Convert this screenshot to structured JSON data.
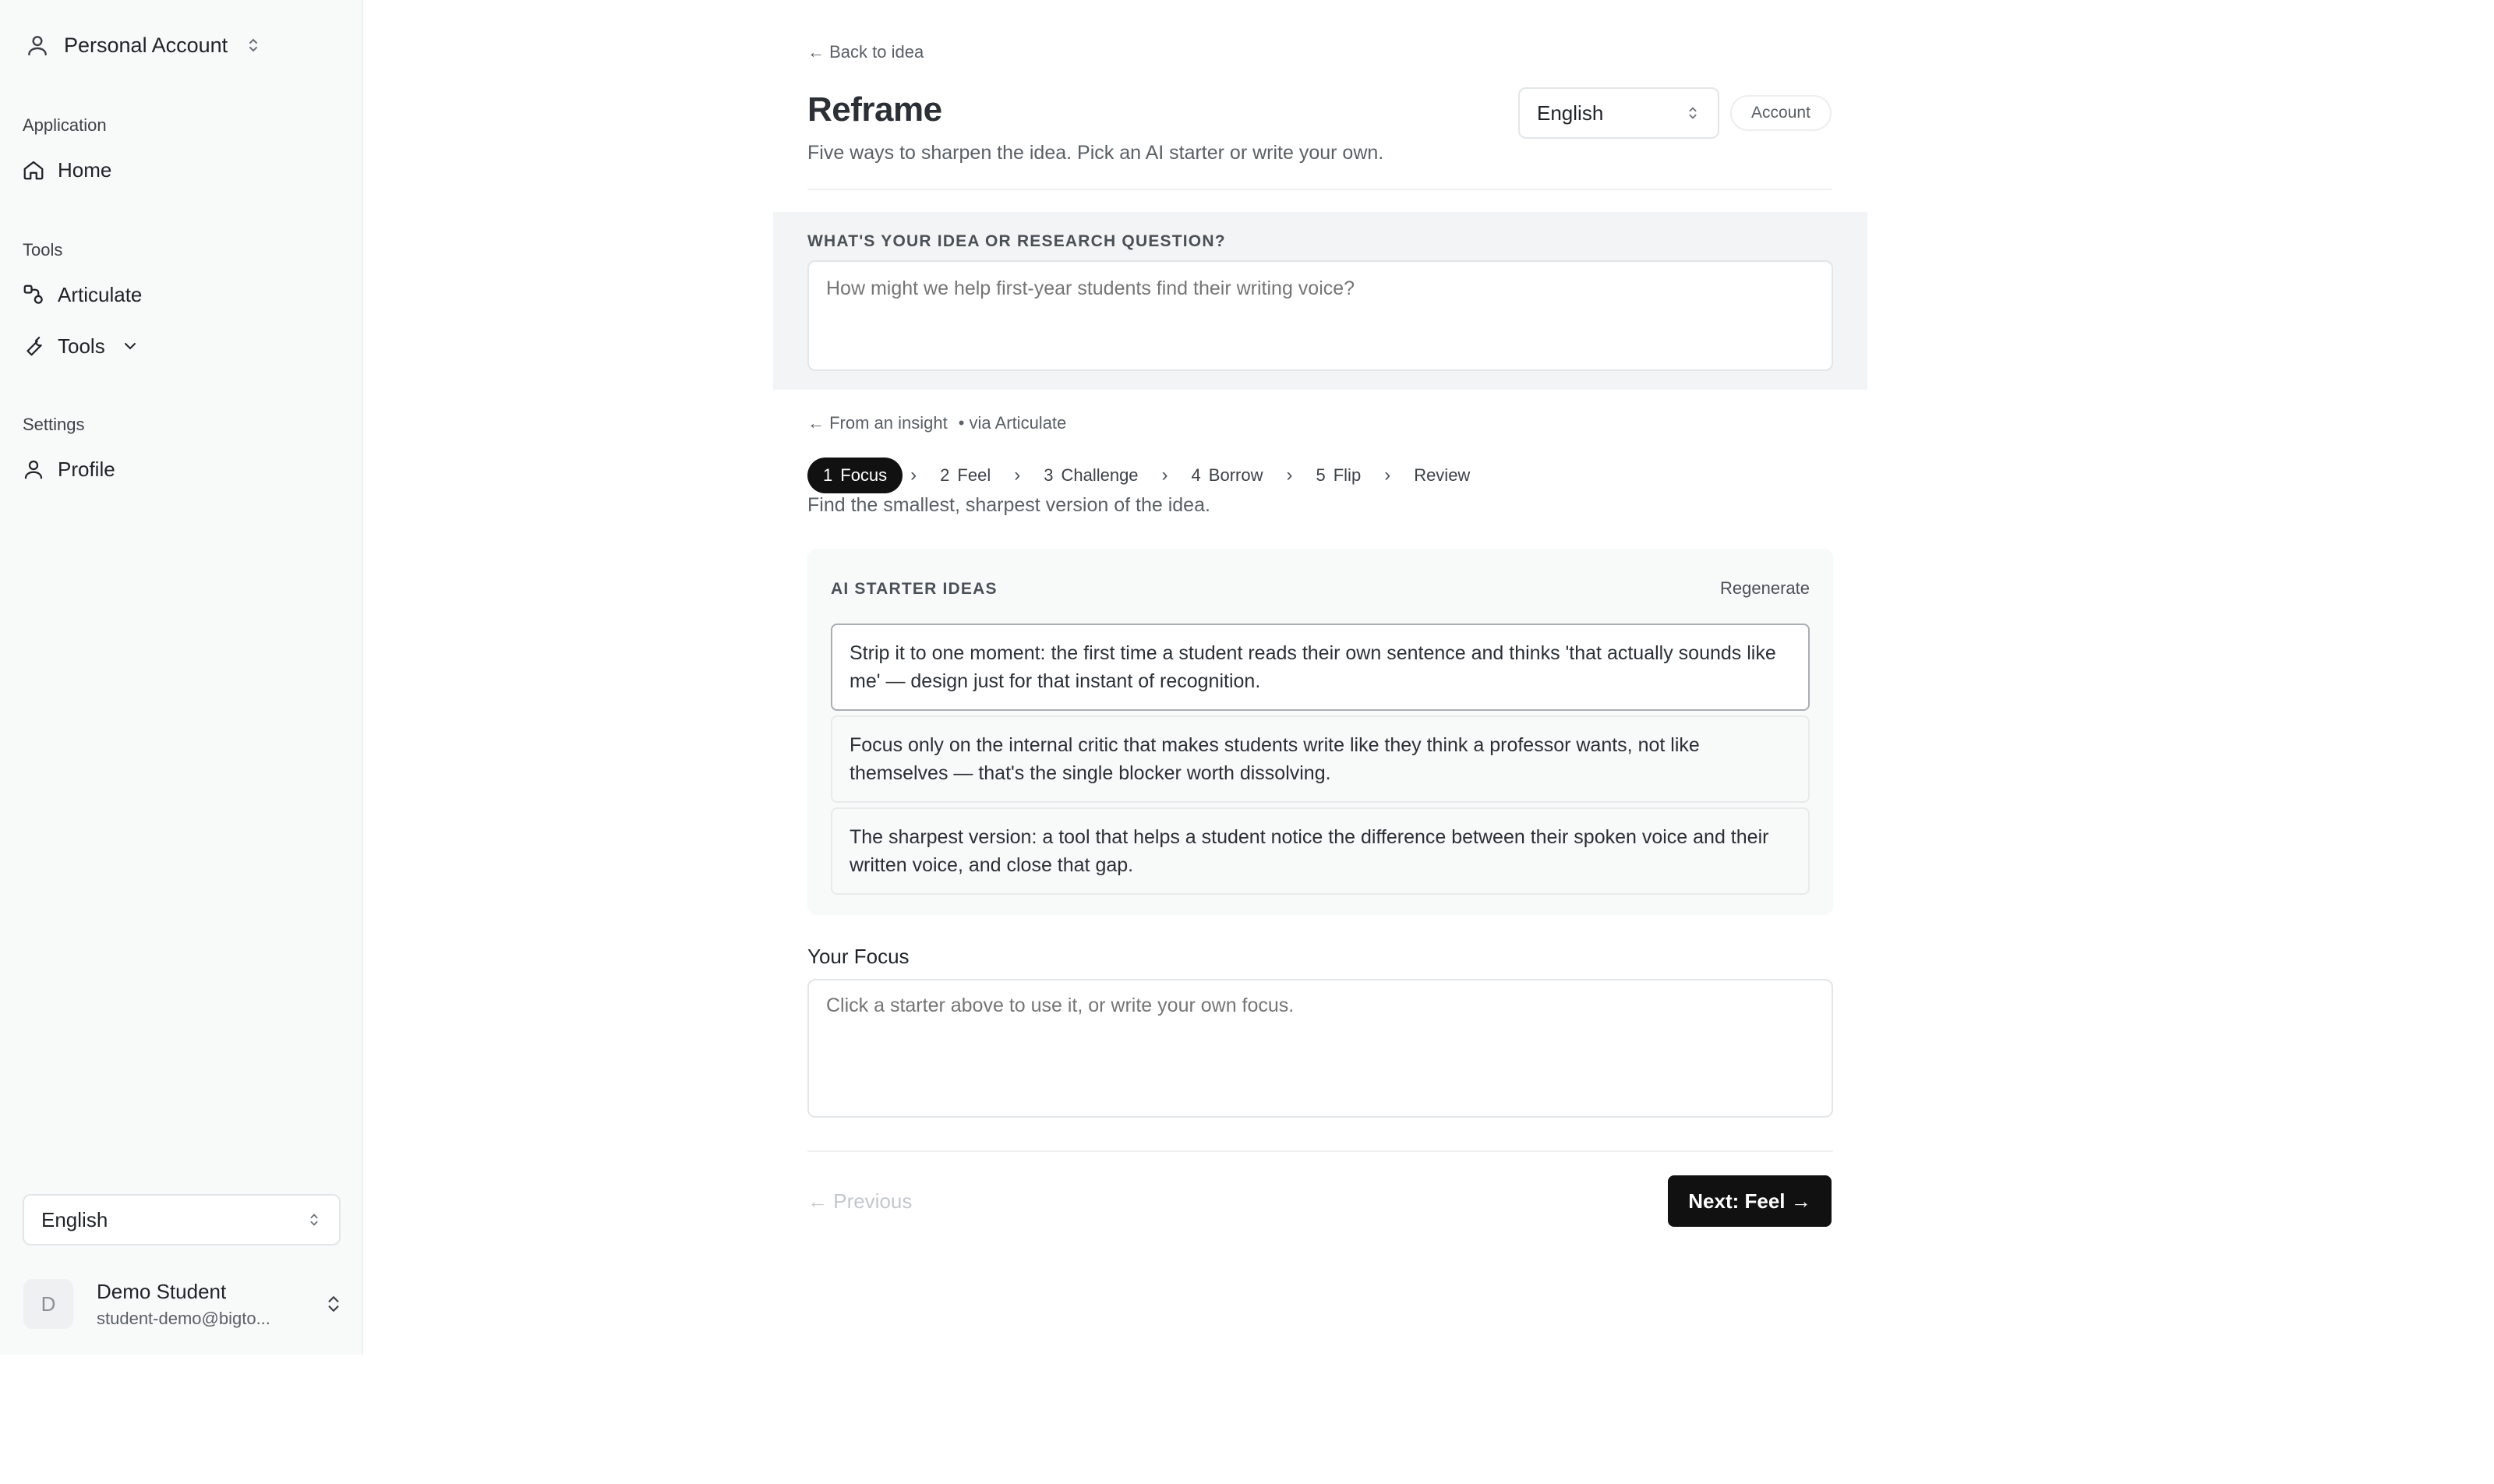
{
  "sidebar": {
    "account_switcher": {
      "label": "Personal Account",
      "icon": "user-icon"
    },
    "groups": [
      {
        "label": "Application",
        "items": [
          {
            "label": "Home",
            "icon": "home-icon"
          }
        ]
      },
      {
        "label": "Tools",
        "items": [
          {
            "label": "Articulate",
            "icon": "articulate-icon"
          },
          {
            "label": "Tools",
            "icon": "wrench-icon"
          }
        ]
      },
      {
        "label": "Settings",
        "items": [
          {
            "label": "Profile",
            "icon": "user-icon"
          }
        ]
      }
    ],
    "language": "English",
    "user": {
      "initial": "D",
      "name": "Demo Student",
      "email": "student-demo@bigto..."
    }
  },
  "header": {
    "back_link": "← Back to idea",
    "title": "Reframe",
    "subtitle": "Five ways to sharpen the idea. Pick an AI starter or write your own.",
    "language": "English",
    "account_button": "Account"
  },
  "question": {
    "label": "WHAT'S YOUR IDEA OR RESEARCH QUESTION?",
    "placeholder": "How might we help first-year students find their writing voice?"
  },
  "source": {
    "from": "← From an insight",
    "via": "• via Articulate"
  },
  "steps": [
    {
      "num": "1",
      "label": "Focus",
      "active": true
    },
    {
      "num": "2",
      "label": "Feel",
      "active": false
    },
    {
      "num": "3",
      "label": "Challenge",
      "active": false
    },
    {
      "num": "4",
      "label": "Borrow",
      "active": false
    },
    {
      "num": "5",
      "label": "Flip",
      "active": false
    },
    {
      "num": "",
      "label": "Review",
      "active": false
    }
  ],
  "step_separator": "›",
  "step_description": "Find the smallest, sharpest version of the idea.",
  "starters": {
    "heading": "AI STARTER IDEAS",
    "regenerate": "Regenerate",
    "items": [
      "Strip it to one moment: the first time a student reads their own sentence and thinks 'that actually sounds like me' — design just for that instant of recognition.",
      "Focus only on the internal critic that makes students write like they think a professor wants, not like themselves — that's the single blocker worth dissolving.",
      "The sharpest version: a tool that helps a student notice the difference between their spoken voice and their written voice, and close that gap."
    ]
  },
  "focus": {
    "label": "Your Focus",
    "placeholder": "Click a starter above to use it, or write your own focus."
  },
  "footer": {
    "previous": "← Previous",
    "next": "Next: Feel →"
  },
  "colors": {
    "accent": "#111111",
    "sidebar_bg": "#f8f9f9",
    "band_bg": "#f3f4f5"
  }
}
